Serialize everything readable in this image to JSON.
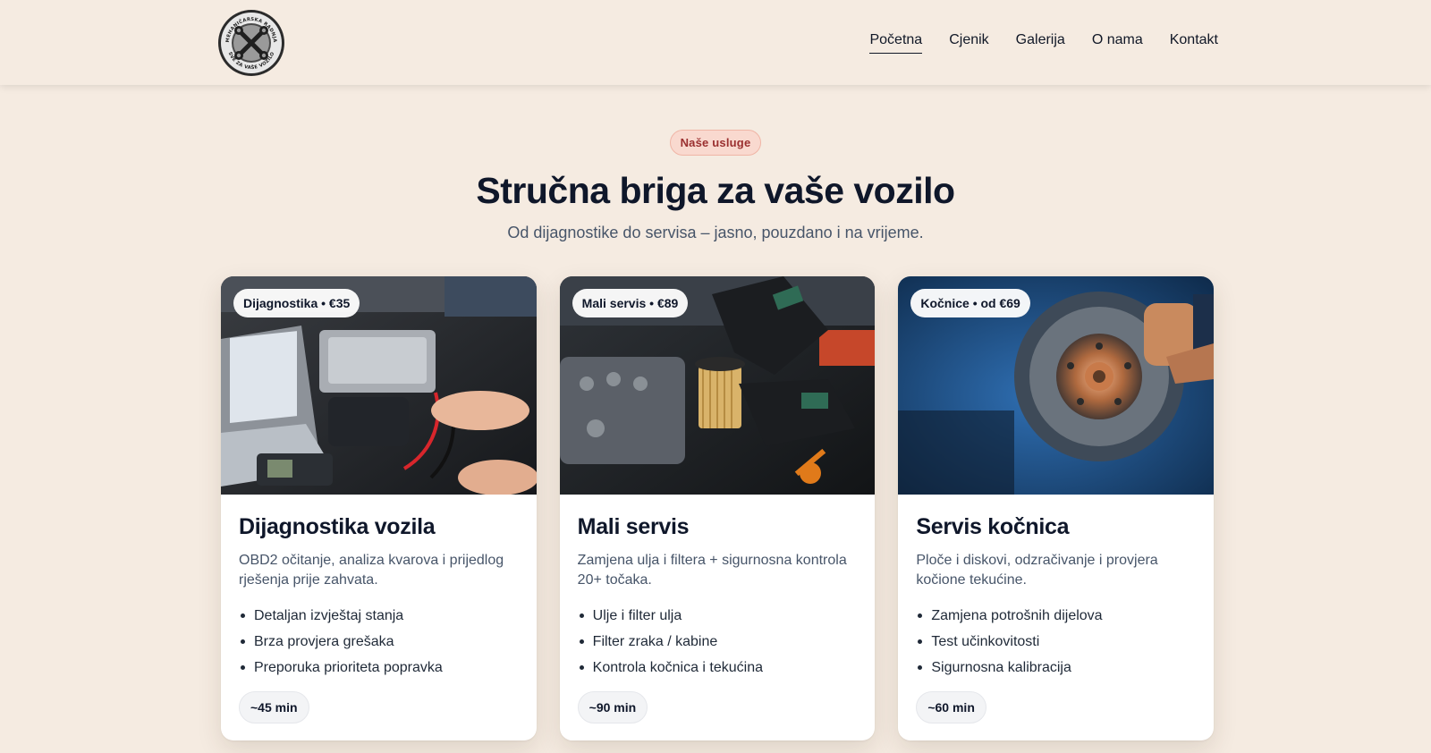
{
  "logo": {
    "top_text": "MEHANIČARSKA RADNJA",
    "bottom_text": "SVE ZA VAŠE VOZILO"
  },
  "nav": {
    "items": [
      {
        "label": "Početna",
        "active": true
      },
      {
        "label": "Cjenik",
        "active": false
      },
      {
        "label": "Galerija",
        "active": false
      },
      {
        "label": "O nama",
        "active": false
      },
      {
        "label": "Kontakt",
        "active": false
      }
    ]
  },
  "hero": {
    "badge": "Naše usluge",
    "title": "Stručna briga za vaše vozilo",
    "subtitle": "Od dijagnostike do servisa – jasno, pouzdano i na vrijeme."
  },
  "cards": [
    {
      "badge": "Dijagnostika • €35",
      "title": "Dijagnostika vozila",
      "description": "OBD2 očitanje, analiza kvarova i prijedlog rješenja prije zahvata.",
      "features": [
        "Detaljan izvještaj stanja",
        "Brza provjera grešaka",
        "Preporuka prioriteta popravka"
      ],
      "duration": "~45 min",
      "image": "engine-diagnostics-photo"
    },
    {
      "badge": "Mali servis • €89",
      "title": "Mali servis",
      "description": "Zamjena ulja i filtera + sigurnosna kontrola 20+ točaka.",
      "features": [
        "Ulje i filter ulja",
        "Filter zraka / kabine",
        "Kontrola kočnica i tekućina"
      ],
      "duration": "~90 min",
      "image": "oil-filter-service-photo"
    },
    {
      "badge": "Kočnice • od €69",
      "title": "Servis kočnica",
      "description": "Ploče i diskovi, odzračivanje i provjera kočione tekućine.",
      "features": [
        "Zamjena potrošnih dijelova",
        "Test učinkovitosti",
        "Sigurnosna kalibracija"
      ],
      "duration": "~60 min",
      "image": "brake-disc-photo"
    }
  ],
  "colors": {
    "page_bg": "#f5ebe1",
    "accent_badge_bg": "#f9d9cf",
    "accent_badge_text": "#9a2f2f",
    "heading": "#0f172a"
  }
}
